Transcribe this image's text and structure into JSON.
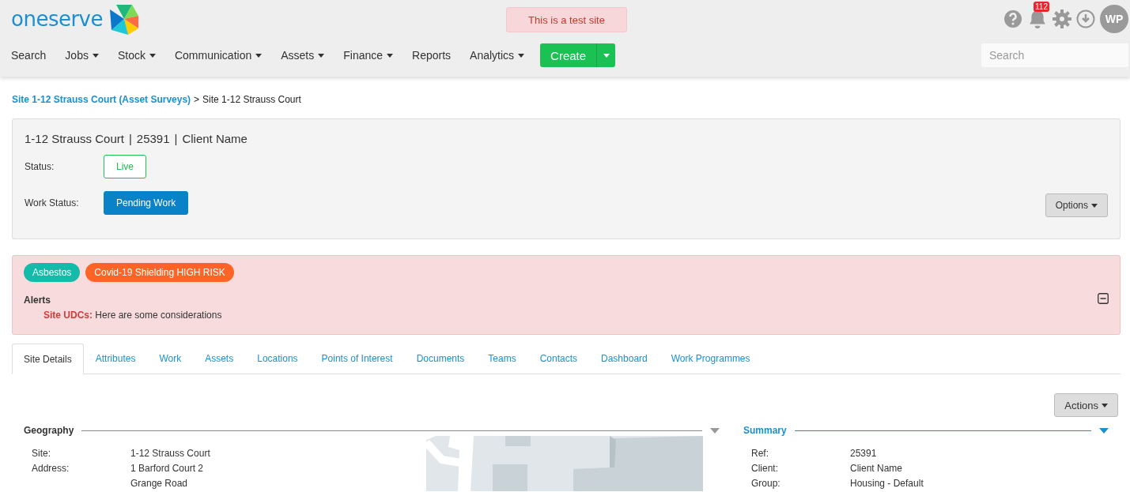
{
  "header": {
    "logo": "oneserve",
    "test_banner": "This is a test site",
    "notification_count": "112",
    "avatar": "WP",
    "nav": [
      {
        "label": "Search",
        "dropdown": false
      },
      {
        "label": "Jobs",
        "dropdown": true
      },
      {
        "label": "Stock",
        "dropdown": true
      },
      {
        "label": "Communication",
        "dropdown": true
      },
      {
        "label": "Assets",
        "dropdown": true
      },
      {
        "label": "Finance",
        "dropdown": true
      },
      {
        "label": "Reports",
        "dropdown": false
      },
      {
        "label": "Analytics",
        "dropdown": true
      }
    ],
    "create": "Create",
    "search": {
      "placeholder": "Search"
    }
  },
  "breadcrumb": {
    "link": "Site 1-12 Strauss Court (Asset Surveys)",
    "separator": ">",
    "current": "Site 1-12 Strauss Court"
  },
  "site": {
    "title": [
      "1-12 Strauss Court",
      "25391",
      "Client Name"
    ],
    "separator": "|",
    "statuses": [
      {
        "label": "Status:",
        "value": "Live",
        "kind": "outline"
      },
      {
        "label": "Work Status:",
        "value": "Pending Work",
        "kind": "solid"
      }
    ],
    "options": "Options"
  },
  "alerts": {
    "tags": [
      {
        "label": "Asbestos",
        "color": "#13bba8"
      },
      {
        "label": "Covid-19 Shielding HIGH RISK",
        "color": "#ff6326"
      }
    ],
    "title": "Alerts",
    "expanded": true,
    "items": [
      "**Site UDCs:** Here are some considerations"
    ]
  },
  "tabs": [
    {
      "label": "Site Details",
      "selected": true
    },
    {
      "label": "Attributes",
      "selected": false
    },
    {
      "label": "Work",
      "selected": false
    },
    {
      "label": "Assets",
      "selected": false
    },
    {
      "label": "Locations",
      "selected": false
    },
    {
      "label": "Points of Interest",
      "selected": false
    },
    {
      "label": "Documents",
      "selected": false
    },
    {
      "label": "Teams",
      "selected": false
    },
    {
      "label": "Contacts",
      "selected": false
    },
    {
      "label": "Dashboard",
      "selected": false
    },
    {
      "label": "Work Programmes",
      "selected": false
    }
  ],
  "actions": "Actions",
  "geography": {
    "title": "Geography",
    "expanded": false,
    "fields": [
      {
        "label": "Site:",
        "values": [
          "1-12 Strauss Court"
        ]
      },
      {
        "label": "Address:",
        "values": [
          "1 Barford Court 2",
          "Grange Road"
        ]
      }
    ]
  },
  "summary": {
    "title": "Summary",
    "expanded": true,
    "fields": [
      {
        "label": "Ref:",
        "values": [
          "25391"
        ]
      },
      {
        "label": "Client:",
        "values": [
          "Client Name"
        ]
      },
      {
        "label": "Group:",
        "values": [
          "Housing - Default"
        ]
      }
    ]
  }
}
